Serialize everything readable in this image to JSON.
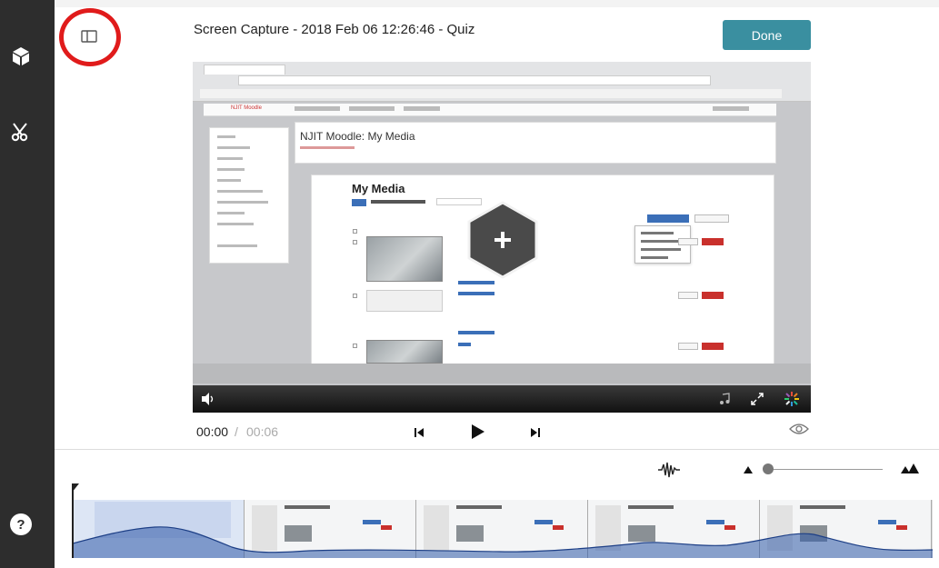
{
  "header": {
    "title": "Screen Capture - 2018 Feb 06 12:26:46 - Quiz",
    "done_label": "Done"
  },
  "video": {
    "moodle_title": "NJIT Moodle: My Media",
    "media_title": "My Media",
    "brand": "NJIT Moodle"
  },
  "transport": {
    "current_time": "00:00",
    "separator": "/",
    "duration": "00:06"
  },
  "sidebar": {
    "help_label": "?"
  },
  "icons": {
    "rail": [
      "interactive-cube-icon",
      "scissors-icon",
      "help-icon"
    ],
    "header": [
      "layout-toggle-icon"
    ],
    "transport": [
      "step-back-icon",
      "play-icon",
      "step-forward-icon",
      "eye-icon"
    ],
    "timeline": [
      "waveform-icon",
      "zoom-out-icon",
      "zoom-in-icon"
    ]
  },
  "colors": {
    "rail": "#2d2d2d",
    "accent": "#3a8fa0",
    "highlight": "#e01b1b",
    "waveform": "#2f5aa8"
  }
}
